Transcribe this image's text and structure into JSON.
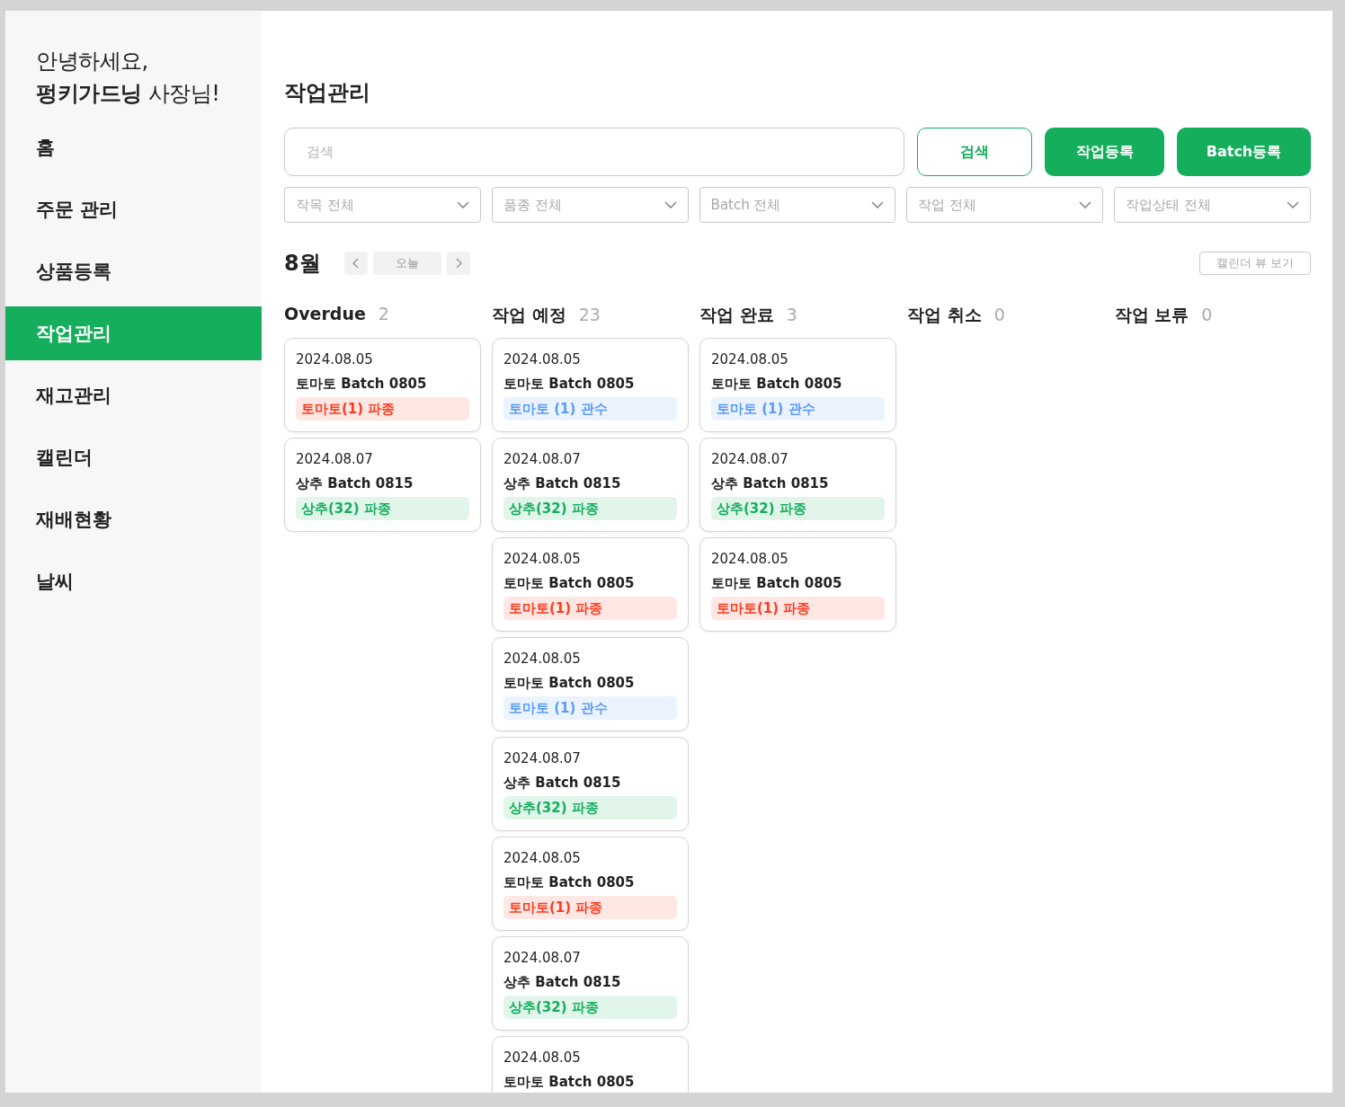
{
  "sidebar": {
    "greeting_line": "안녕하세요,",
    "user_name": "펑키가드닝",
    "user_suffix": "사장님!",
    "items": [
      {
        "label": "홈",
        "selected": false
      },
      {
        "label": "주문 관리",
        "selected": false
      },
      {
        "label": "상품등록",
        "selected": false
      },
      {
        "label": "작업관리",
        "selected": true
      },
      {
        "label": "재고관리",
        "selected": false
      },
      {
        "label": "캘린더",
        "selected": false
      },
      {
        "label": "재배현황",
        "selected": false
      },
      {
        "label": "날씨",
        "selected": false
      }
    ]
  },
  "page_title": "작업관리",
  "search": {
    "placeholder": "검색"
  },
  "buttons": [
    {
      "label": "검색",
      "kind": "outline"
    },
    {
      "label": "작업등록",
      "kind": "filled"
    },
    {
      "label": "Batch등록",
      "kind": "filled"
    }
  ],
  "filters": [
    {
      "placeholder": "작목 전체"
    },
    {
      "placeholder": "품종 전체"
    },
    {
      "placeholder": "Batch 전체"
    },
    {
      "placeholder": "작업 전체"
    },
    {
      "placeholder": "작업상태 전체"
    }
  ],
  "month_nav": {
    "month": "8월",
    "today": "오늘",
    "view_toggle": "캘린더 뷰 보기"
  },
  "columns": [
    {
      "title": "Overdue",
      "count": "2",
      "cards": [
        {
          "date": "2024.08.05",
          "title": "토마토 Batch 0805",
          "tag": {
            "label": "토마토(1) 파종",
            "color": "#ff3b1f"
          }
        },
        {
          "date": "2024.08.07",
          "title": "상추 Batch 0815",
          "tag": {
            "label": "상추(32) 파종",
            "color": "#14ae5c"
          }
        }
      ]
    },
    {
      "title": "작업 예정",
      "count": "23",
      "cards": [
        {
          "date": "2024.08.05",
          "title": "토마토 Batch 0805",
          "tag": {
            "label": "토마토 (1) 관수",
            "color": "#5b9cf8"
          }
        },
        {
          "date": "2024.08.07",
          "title": "상추 Batch 0815",
          "tag": {
            "label": "상추(32) 파종",
            "color": "#14ae5c"
          }
        },
        {
          "date": "2024.08.05",
          "title": "토마토 Batch 0805",
          "tag": {
            "label": "토마토(1) 파종",
            "color": "#ff3b1f"
          }
        },
        {
          "date": "2024.08.05",
          "title": "토마토 Batch 0805",
          "tag": {
            "label": "토마토 (1) 관수",
            "color": "#5b9cf8"
          }
        },
        {
          "date": "2024.08.07",
          "title": "상추 Batch 0815",
          "tag": {
            "label": "상추(32) 파종",
            "color": "#14ae5c"
          }
        },
        {
          "date": "2024.08.05",
          "title": "토마토 Batch 0805",
          "tag": {
            "label": "토마토(1) 파종",
            "color": "#ff3b1f"
          }
        },
        {
          "date": "2024.08.07",
          "title": "상추 Batch 0815",
          "tag": {
            "label": "상추(32) 파종",
            "color": "#14ae5c"
          }
        },
        {
          "date": "2024.08.05",
          "title": "토마토 Batch 0805"
        }
      ]
    },
    {
      "title": "작업 완료",
      "count": "3",
      "cards": [
        {
          "date": "2024.08.05",
          "title": "토마토 Batch 0805",
          "tag": {
            "label": "토마토 (1) 관수",
            "color": "#5b9cf8"
          }
        },
        {
          "date": "2024.08.07",
          "title": "상추 Batch 0815",
          "tag": {
            "label": "상추(32) 파종",
            "color": "#14ae5c"
          }
        },
        {
          "date": "2024.08.05",
          "title": "토마토 Batch 0805",
          "tag": {
            "label": "토마토(1) 파종",
            "color": "#ff3b1f"
          }
        }
      ]
    },
    {
      "title": "작업 취소",
      "count": "0"
    },
    {
      "title": "작업 보류",
      "count": "0"
    }
  ]
}
